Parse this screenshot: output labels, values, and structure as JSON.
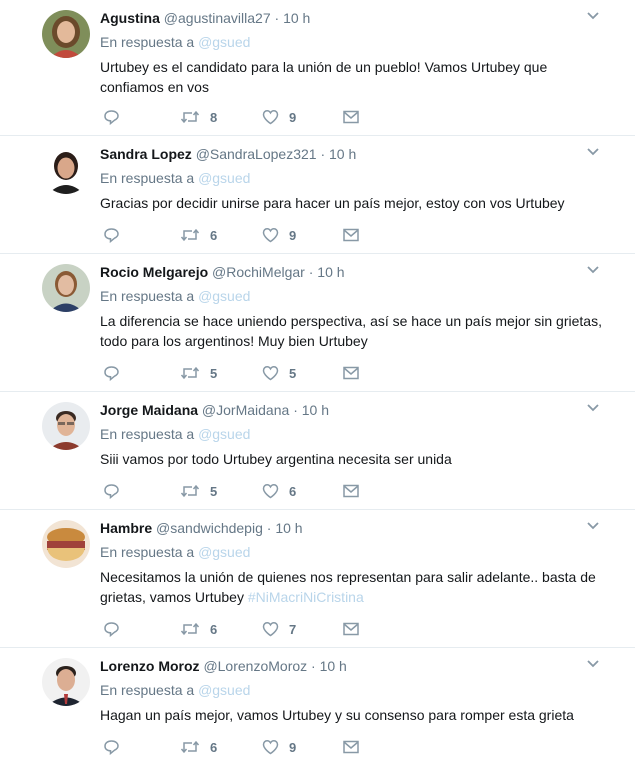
{
  "reply_prefix": "En respuesta a",
  "reply_to": "@gsued",
  "tweets": [
    {
      "name": "Agustina",
      "handle": "@agustinavilla27",
      "time": "10 h",
      "text": "Urtubey es el candidato para la unión de un pueblo! Vamos Urtubey que confiamos en vos",
      "hashtag": "",
      "replies": "",
      "retweets": "8",
      "likes": "9",
      "avatar_colors": {
        "bg": "#7f8e5a",
        "hair": "#6b4a2b",
        "skin": "#e3b99a",
        "shirt": "#c14a3c"
      }
    },
    {
      "name": "Sandra Lopez",
      "handle": "@SandraLopez321",
      "time": "10 h",
      "text": "Gracias por decidir unirse para hacer un país mejor, estoy con vos Urtubey",
      "hashtag": "",
      "replies": "",
      "retweets": "6",
      "likes": "9",
      "avatar_colors": {
        "bg": "#ffffff",
        "hair": "#2b1d18",
        "skin": "#d9a78a",
        "shirt": "#1f1f1f"
      }
    },
    {
      "name": "Rocio Melgarejo",
      "handle": "@RochiMelgar",
      "time": "10 h",
      "text": "La diferencia se hace uniendo perspectiva, así se hace un país mejor sin grietas, todo para los argentinos! Muy bien Urtubey",
      "hashtag": "",
      "replies": "",
      "retweets": "5",
      "likes": "5",
      "avatar_colors": {
        "bg": "#c8d2c4",
        "hair": "#8a5a35",
        "skin": "#e2bca2",
        "shirt": "#2c3f66"
      }
    },
    {
      "name": "Jorge Maidana",
      "handle": "@JorMaidana",
      "time": "10 h",
      "text": "Siii vamos por todo Urtubey argentina necesita ser unida",
      "hashtag": "",
      "replies": "",
      "retweets": "5",
      "likes": "6",
      "avatar_colors": {
        "bg": "#e9ecef",
        "hair": "#3a2a22",
        "skin": "#e0b497",
        "shirt": "#8c3b2e"
      }
    },
    {
      "name": "Hambre",
      "handle": "@sandwichdepig",
      "time": "10 h",
      "text": "Necesitamos la unión de quienes nos representan para salir adelante.. basta de grietas, vamos Urtubey",
      "hashtag": "#NiMacriNiCristina",
      "replies": "",
      "retweets": "6",
      "likes": "7",
      "avatar_colors": {
        "bg": "#f2e4d4",
        "hair": "#c98a3e",
        "skin": "#a0413a",
        "shirt": "#e9c27a"
      }
    },
    {
      "name": "Lorenzo Moroz",
      "handle": "@LorenzoMoroz",
      "time": "10 h",
      "text": "Hagan un país mejor, vamos Urtubey y su consenso para romper esta grieta",
      "hashtag": "",
      "replies": "",
      "retweets": "6",
      "likes": "9",
      "avatar_colors": {
        "bg": "#f1f1f1",
        "hair": "#2a211c",
        "skin": "#dcae93",
        "shirt": "#1e2430"
      }
    }
  ]
}
